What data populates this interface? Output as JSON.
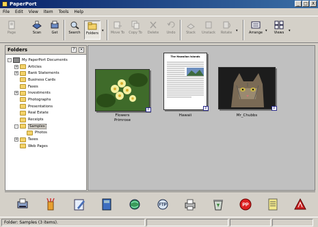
{
  "window": {
    "title": "PaperPort",
    "controls": [
      "_",
      "□",
      "X"
    ]
  },
  "menu": [
    "File",
    "Edit",
    "View",
    "Item",
    "Tools",
    "Help"
  ],
  "toolbar": {
    "buttons": [
      {
        "label": "Page",
        "icon": "page-icon",
        "enabled": false
      },
      {
        "label": "Scan",
        "icon": "scanner-icon",
        "enabled": true
      },
      {
        "label": "Get",
        "icon": "get-icon",
        "enabled": true
      },
      {
        "label": "Search",
        "icon": "search-icon",
        "enabled": true
      },
      {
        "label": "Folders",
        "icon": "folders-icon",
        "enabled": true
      },
      {
        "label": "Move To",
        "icon": "move-to-icon",
        "enabled": false
      },
      {
        "label": "Copy To",
        "icon": "copy-to-icon",
        "enabled": false
      },
      {
        "label": "Delete",
        "icon": "delete-icon",
        "enabled": false
      },
      {
        "label": "Undo",
        "icon": "undo-icon",
        "enabled": false
      },
      {
        "label": "Stack",
        "icon": "stack-icon",
        "enabled": false
      },
      {
        "label": "Unstack",
        "icon": "unstack-icon",
        "enabled": false
      },
      {
        "label": "Rotate",
        "icon": "rotate-icon",
        "enabled": false
      },
      {
        "label": "Arrange",
        "icon": "arrange-icon",
        "enabled": true
      },
      {
        "label": "Views",
        "icon": "views-icon",
        "enabled": true
      }
    ]
  },
  "folders": {
    "title": "Folders",
    "tree": [
      {
        "label": "My PaperPort Documents",
        "level": 0,
        "expander": "-"
      },
      {
        "label": "Articles",
        "level": 1,
        "expander": "+"
      },
      {
        "label": "Bank Statements",
        "level": 1,
        "expander": "+"
      },
      {
        "label": "Business Cards",
        "level": 1,
        "expander": ""
      },
      {
        "label": "Faxes",
        "level": 1,
        "expander": ""
      },
      {
        "label": "Investments",
        "level": 1,
        "expander": "+"
      },
      {
        "label": "Photographs",
        "level": 1,
        "expander": ""
      },
      {
        "label": "Presentations",
        "level": 1,
        "expander": ""
      },
      {
        "label": "Real Estate",
        "level": 1,
        "expander": ""
      },
      {
        "label": "Receipts",
        "level": 1,
        "expander": ""
      },
      {
        "label": "Samples",
        "level": 1,
        "expander": "-",
        "selected": true
      },
      {
        "label": "Photos",
        "level": 2,
        "expander": ""
      },
      {
        "label": "Taxes",
        "level": 1,
        "expander": "+"
      },
      {
        "label": "Web Pages",
        "level": 1,
        "expander": ""
      }
    ]
  },
  "workspace": {
    "items": [
      {
        "caption": "Flowers",
        "caption2": "Primrose"
      },
      {
        "caption": "Hawaii",
        "caption2": "",
        "doc_title": "The Hawaiian Islands"
      },
      {
        "caption": "Mr_Chubbs",
        "caption2": ""
      }
    ]
  },
  "sendto_bar": {
    "apps": [
      "scan-app-icon",
      "paint-app-icon",
      "editor-app-icon",
      "book-app-icon",
      "globe-app-icon",
      "ftp-app-icon",
      "printer-app-icon",
      "recycle-app-icon",
      "pp-app-icon",
      "notepad-app-icon",
      "acrobat-app-icon"
    ],
    "ftp_label": "FTP",
    "pp_label": "PP"
  },
  "status": {
    "text": "Folder: Samples (3 items)."
  }
}
